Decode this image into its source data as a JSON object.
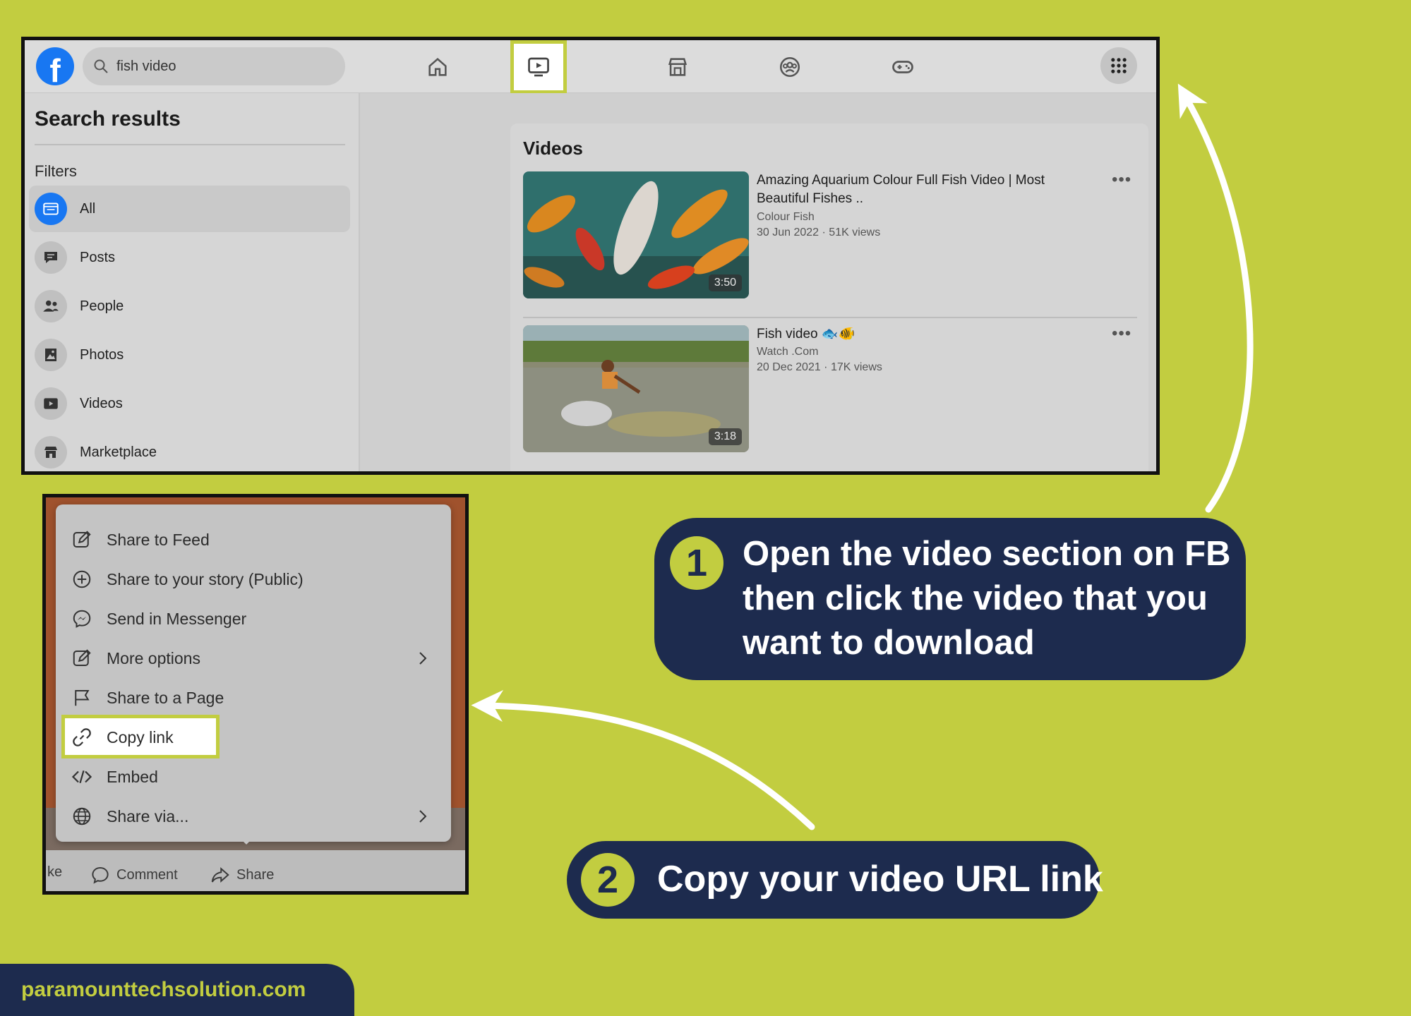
{
  "colors": {
    "background": "#c2cd40",
    "callout": "#1d2b4e",
    "accent": "#c2cd40",
    "facebook_blue": "#1877f2"
  },
  "facebook": {
    "logo": "f",
    "search": {
      "value": "fish video"
    },
    "nav_icons": [
      "home-icon",
      "watch-icon",
      "marketplace-icon",
      "groups-icon",
      "gaming-icon",
      "menu-grid-icon"
    ],
    "sidebar": {
      "title": "Search results",
      "filters_label": "Filters",
      "filters": [
        {
          "label": "All",
          "icon": "all-icon"
        },
        {
          "label": "Posts",
          "icon": "posts-icon"
        },
        {
          "label": "People",
          "icon": "people-icon"
        },
        {
          "label": "Photos",
          "icon": "photos-icon"
        },
        {
          "label": "Videos",
          "icon": "videos-icon"
        },
        {
          "label": "Marketplace",
          "icon": "marketplace-icon"
        }
      ]
    },
    "videos": {
      "heading": "Videos",
      "items": [
        {
          "title": "Amazing Aquarium Colour Full Fish Video | Most Beautiful Fishes ..",
          "channel": "Colour Fish",
          "meta": "30 Jun 2022 · 51K views",
          "duration": "3:50",
          "more": "•••"
        },
        {
          "title": "Fish video 🐟🐠",
          "channel": "Watch .Com",
          "meta": "20 Dec 2021 · 17K views",
          "duration": "3:18",
          "more": "•••"
        }
      ]
    }
  },
  "share_menu": {
    "items": [
      {
        "label": "Share to Feed",
        "icon": "edit-icon"
      },
      {
        "label": "Share to your story (Public)",
        "icon": "plus-circle-icon"
      },
      {
        "label": "Send in Messenger",
        "icon": "messenger-icon"
      },
      {
        "label": "More options",
        "icon": "edit-icon"
      },
      {
        "label": "Share to a Page",
        "icon": "flag-icon"
      },
      {
        "label": "Copy link",
        "icon": "link-icon"
      },
      {
        "label": "Embed",
        "icon": "code-icon"
      },
      {
        "label": "Share via...",
        "icon": "globe-icon"
      }
    ],
    "bottom_actions": {
      "like_partial": "ke",
      "comment": "Comment",
      "share": "Share"
    }
  },
  "callouts": {
    "step1": {
      "number": "1",
      "text": "Open the video section on FB then click the video that you want to download"
    },
    "step2": {
      "number": "2",
      "text": "Copy your video URL link"
    }
  },
  "site": "paramounttechsolution.com"
}
